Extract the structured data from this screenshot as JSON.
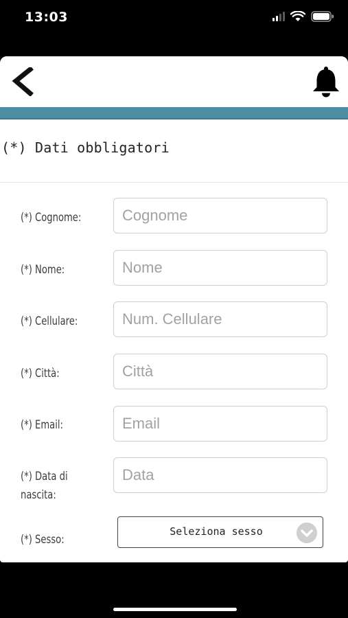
{
  "status_bar": {
    "time": "13:03"
  },
  "header": {
    "back_icon": "chevron-left-icon",
    "notification_icon": "bell-icon"
  },
  "required_note": "(*) Dati obbligatori",
  "form": {
    "fields": [
      {
        "label": "(*) Cognome:",
        "placeholder": "Cognome"
      },
      {
        "label": "(*) Nome:",
        "placeholder": "Nome"
      },
      {
        "label": "(*) Cellulare:",
        "placeholder": "Num. Cellulare"
      },
      {
        "label": "(*) Città:",
        "placeholder": "Città"
      },
      {
        "label": "(*) Email:",
        "placeholder": "Email"
      },
      {
        "label_line1": "(*) Data di",
        "label_line2": "nascita:",
        "placeholder": "Data"
      }
    ],
    "gender": {
      "label": "(*) Sesso:",
      "selected": "Seleziona sesso"
    }
  },
  "colors": {
    "accent_bar": "#4d8ea3",
    "background": "#000000",
    "screen": "#ffffff"
  }
}
